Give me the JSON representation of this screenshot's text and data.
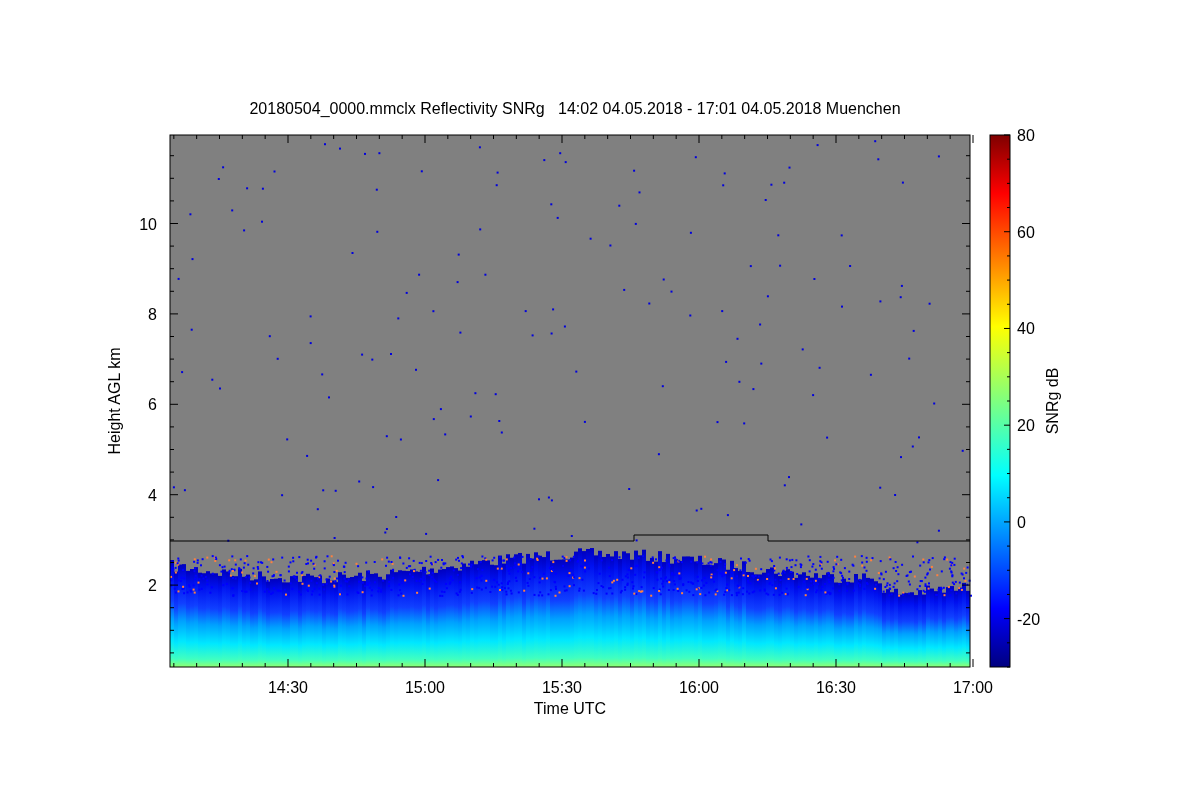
{
  "title": "20180504_0000.mmclx Reflectivity SNRg   14:02 04.05.2018 - 17:01 04.05.2018 Muenchen",
  "x_axis": {
    "label": "Time UTC",
    "ticks": [
      "14:30",
      "15:00",
      "15:30",
      "16:00",
      "16:30",
      "17:00"
    ]
  },
  "y_axis": {
    "label": "Height AGL km",
    "ticks": [
      "10",
      "8",
      "6",
      "4",
      "2"
    ]
  },
  "colorbar": {
    "label": "SNRg dB",
    "ticks": [
      "80",
      "60",
      "40",
      "20",
      "0",
      "-20"
    ]
  }
}
